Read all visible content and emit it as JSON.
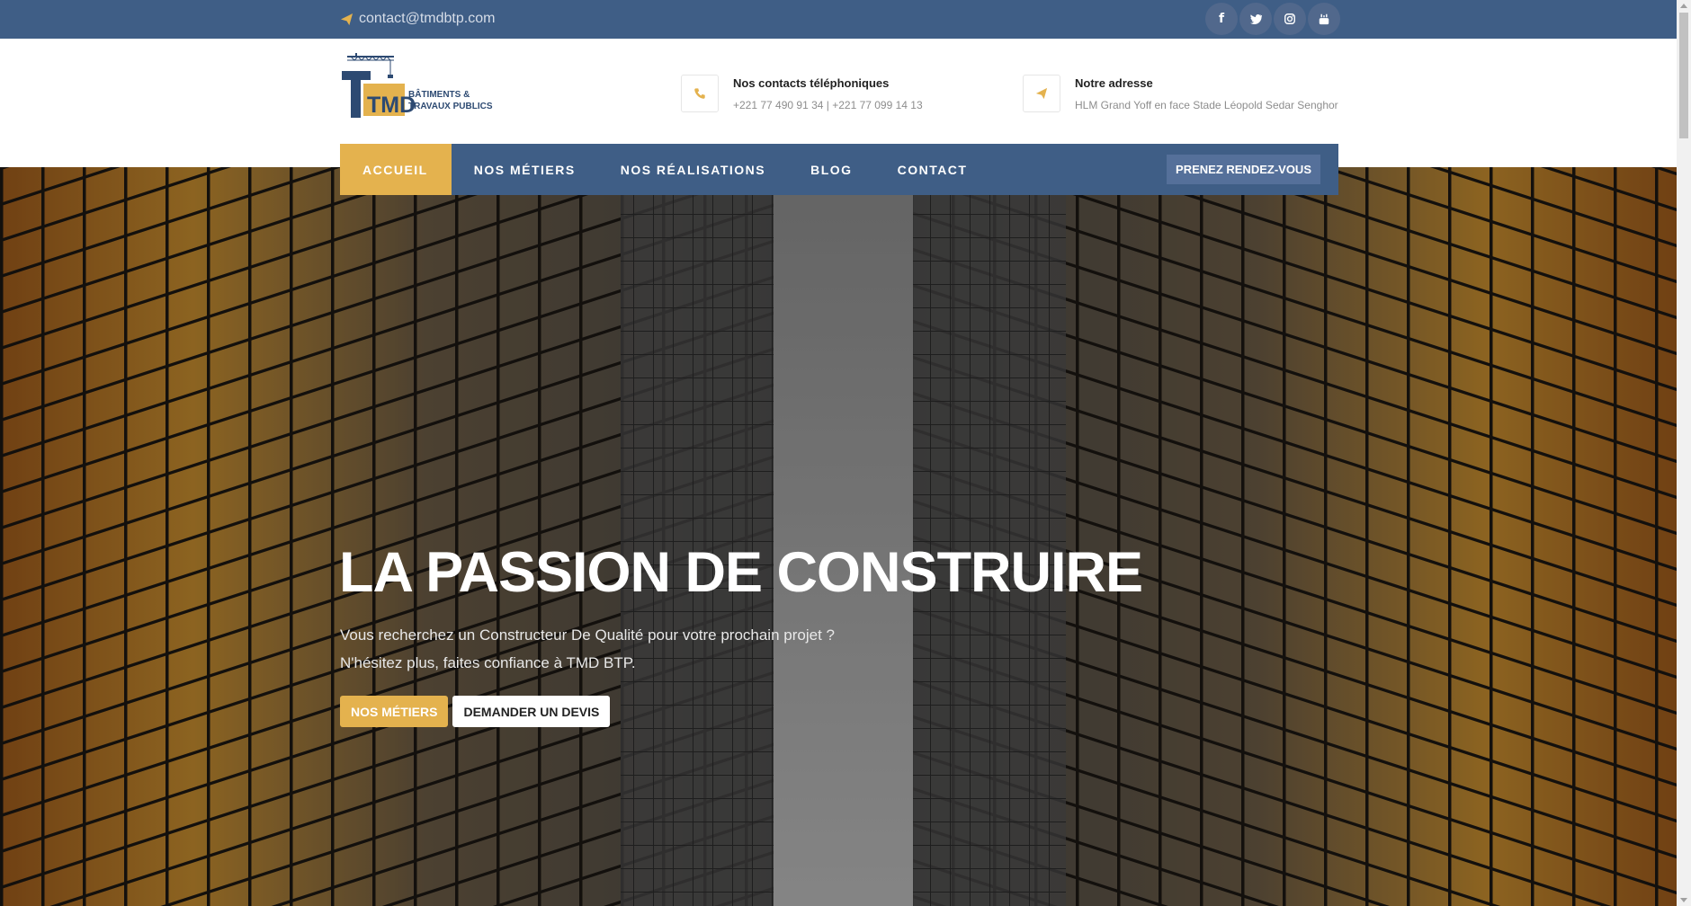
{
  "topbar": {
    "email": "contact@tmdbtp.com",
    "socials": [
      "facebook-icon",
      "twitter-icon",
      "instagram-icon",
      "youtube-icon"
    ]
  },
  "header": {
    "logo": {
      "letters": "TMD",
      "tagline_1": "BÂTIMENTS &",
      "tagline_2": "TRAVAUX PUBLICS"
    },
    "phone": {
      "title": "Nos contacts téléphoniques",
      "value": "+221 77 490 91 34 | +221 77 099 14 13",
      "icon": "phone-icon"
    },
    "address": {
      "title": "Notre adresse",
      "value": "HLM Grand Yoff en face Stade Léopold Sedar Senghor",
      "icon": "paper-plane-icon"
    }
  },
  "nav": {
    "items": [
      {
        "label": "ACCUEIL",
        "active": true
      },
      {
        "label": "NOS MÉTIERS",
        "active": false
      },
      {
        "label": "NOS RÉALISATIONS",
        "active": false
      },
      {
        "label": "BLOG",
        "active": false
      },
      {
        "label": "CONTACT",
        "active": false
      }
    ],
    "cta": "PRENEZ RENDEZ-VOUS"
  },
  "hero": {
    "title": "LA PASSION DE CONSTRUIRE",
    "subtitle_line1": "Vous recherchez un Constructeur De Qualité pour votre prochain projet ?",
    "subtitle_line2": "N'hésitez plus, faites confiance à TMD BTP.",
    "btn_primary": "NOS MÉTIERS",
    "btn_secondary": "DEMANDER UN DEVIS"
  },
  "colors": {
    "primary": "#3f5e86",
    "accent": "#e4b24e",
    "text_dark": "#222222",
    "text_muted": "#8d8d8d"
  }
}
